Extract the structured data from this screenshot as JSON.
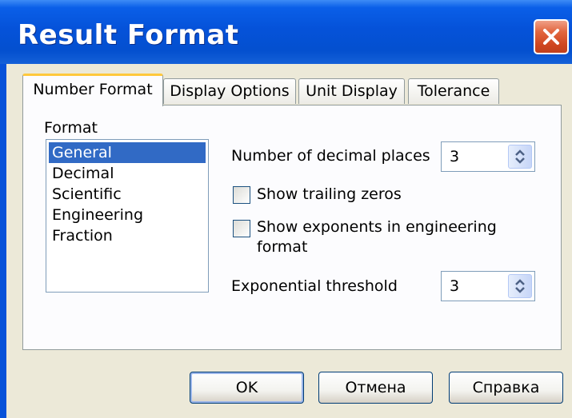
{
  "window": {
    "title": "Result Format"
  },
  "tabs": [
    {
      "label": "Number Format",
      "active": true
    },
    {
      "label": "Display Options",
      "active": false
    },
    {
      "label": "Unit Display",
      "active": false
    },
    {
      "label": "Tolerance",
      "active": false
    }
  ],
  "format": {
    "label": "Format",
    "items": [
      "General",
      "Decimal",
      "Scientific",
      "Engineering",
      "Fraction"
    ],
    "selected": "General"
  },
  "decimal_places": {
    "label": "Number of decimal places",
    "value": "3"
  },
  "trailing_zeros": {
    "label": "Show trailing zeros",
    "checked": false
  },
  "exponents": {
    "label_line1": "Show exponents in engineering",
    "label_line2": "format",
    "checked": false
  },
  "exponential_threshold": {
    "label": "Exponential threshold",
    "value": "3"
  },
  "buttons": {
    "ok": "OK",
    "cancel": "Отмена",
    "help": "Справка"
  },
  "colors": {
    "titlebar": "#0552d9",
    "selection": "#316ac5",
    "close": "#cf4620",
    "active_tab_highlight": "#ffc83c"
  },
  "icons": {
    "close": "close-icon",
    "spin": "spin-up-down-icon"
  }
}
